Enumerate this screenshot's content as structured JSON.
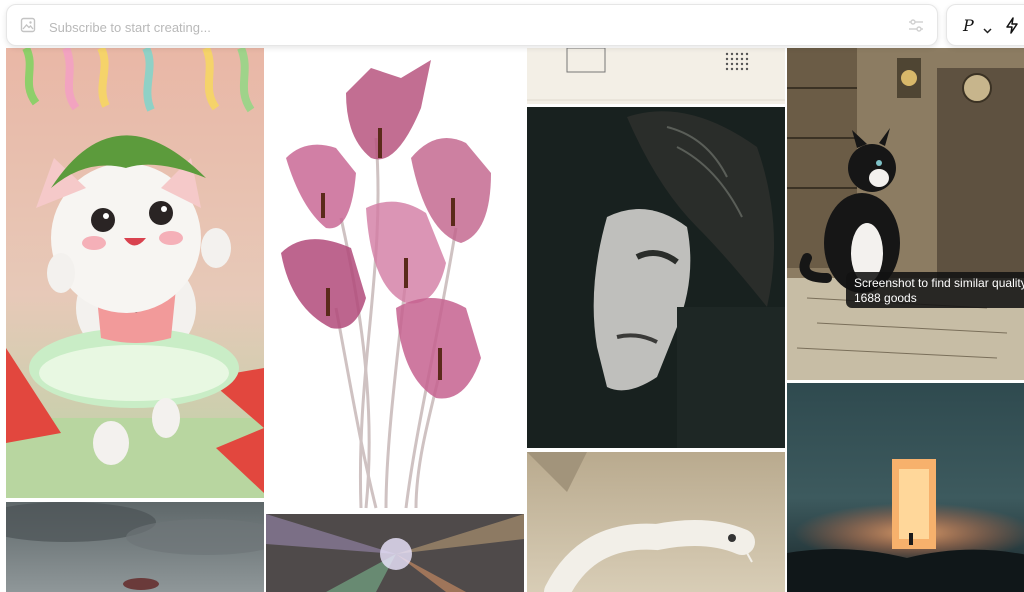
{
  "prompt": {
    "placeholder": "Subscribe to start creating..."
  },
  "mode": {
    "label": "P"
  },
  "tooltip": {
    "line1": "Screenshot to find similar quality",
    "line2": "1688 goods"
  },
  "colors": {
    "bar_border": "#e6e6e6",
    "placeholder": "#b9b9b9",
    "tooltip_bg": "#121212"
  },
  "gallery": [
    {
      "name": "kitten-watermelon-image"
    },
    {
      "name": "pink-tulips-image"
    },
    {
      "name": "notebook-paper-image"
    },
    {
      "name": "face-shadow-portrait-image"
    },
    {
      "name": "cat-antique-room-image"
    },
    {
      "name": "glowing-portal-seascape-image"
    },
    {
      "name": "stormy-sky-image"
    },
    {
      "name": "crystal-burst-image"
    },
    {
      "name": "white-snake-image"
    }
  ]
}
